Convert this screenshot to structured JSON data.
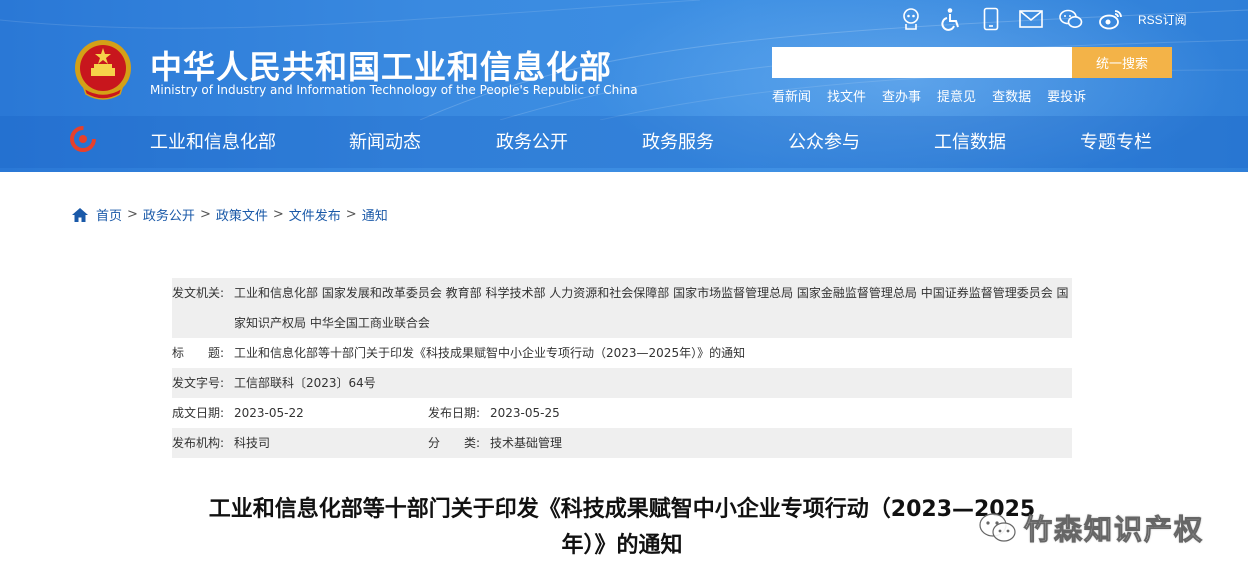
{
  "header": {
    "title_cn": "中华人民共和国工业和信息化部",
    "title_en": "Ministry of Industry and Information Technology of the People's Republic of China",
    "rss_label": "RSS订阅",
    "search_button": "统一搜索",
    "search_value": "",
    "quick_links": [
      "看新闻",
      "找文件",
      "查办事",
      "提意见",
      "查数据",
      "要投诉"
    ],
    "top_icons": [
      "robot-icon",
      "accessibility-icon",
      "mobile-icon",
      "mail-icon",
      "wechat-icon",
      "weibo-icon"
    ]
  },
  "nav": {
    "items": [
      "工业和信息化部",
      "新闻动态",
      "政务公开",
      "政务服务",
      "公众参与",
      "工信数据",
      "专题专栏"
    ]
  },
  "breadcrumb": {
    "items": [
      "首页",
      "政务公开",
      "政策文件",
      "文件发布",
      "通知"
    ],
    "separator": ">"
  },
  "doc_info": {
    "issuer_label": "发文机关:",
    "issuer_line1": "工业和信息化部 国家发展和改革委员会 教育部 科学技术部 人力资源和社会保障部 国家市场监督管理总局 国家金融监督管理总局 中国证券监督管理委员会 国",
    "issuer_line2": "家知识产权局 中华全国工商业联合会",
    "title_label": "标　　题:",
    "title_value": "工业和信息化部等十部门关于印发《科技成果赋智中小企业专项行动（2023—2025年）》的通知",
    "number_label": "发文字号:",
    "number_value": "工信部联科〔2023〕64号",
    "written_label": "成文日期:",
    "written_value": "2023-05-22",
    "published_label": "发布日期:",
    "published_value": "2023-05-25",
    "org_label": "发布机构:",
    "org_value": "科技司",
    "category_label": "分　　类:",
    "category_value": "技术基础管理"
  },
  "document": {
    "title_line1": "工业和信息化部等十部门关于印发《科技成果赋智中小企业专项行动（2023—2025",
    "title_line2": "年）》的通知"
  },
  "watermark": {
    "text": "竹森知识产权"
  },
  "colors": {
    "header_blue": "#3a8ae0",
    "search_button": "#f3b348",
    "link_blue": "#1a59a8",
    "table_shade": "#efefef"
  }
}
